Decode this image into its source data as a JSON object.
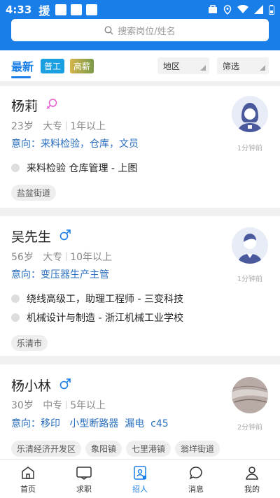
{
  "status_bar": {
    "time": "4:33",
    "carrier_char": "援"
  },
  "search": {
    "placeholder": "搜索岗位/姓名"
  },
  "filters": {
    "latest": "最新",
    "tag_general": "普工",
    "tag_high_pay": "高薪",
    "area": "地区",
    "filter": "筛选"
  },
  "candidates": [
    {
      "name": "杨莉",
      "gender": "female",
      "age": "23岁",
      "education": "大专",
      "experience": "1年以上",
      "intent": "意向：来料检验，仓库，文员",
      "history": [
        "来料检验  仓库管理 - 上图"
      ],
      "locations": [
        "盐盆街道"
      ],
      "ago": "1分钟前"
    },
    {
      "name": "吴先生",
      "gender": "male",
      "age": "56岁",
      "education": "大专",
      "experience": "10年以上",
      "intent": "意向：变压器生产主管",
      "history": [
        "绕线高级工，助理工程师 - 三变科技",
        "机械设计与制造 - 浙江机械工业学校"
      ],
      "locations": [
        "乐清市"
      ],
      "ago": "1分钟前"
    },
    {
      "name": "杨小林",
      "gender": "male",
      "age": "30岁",
      "education": "中专",
      "experience": "5年以上",
      "intent": "意向：移印   小型断路器  漏电  c45",
      "history": [],
      "locations": [
        "乐清经济开发区",
        "象阳镇",
        "七里港镇",
        "翁垟街道"
      ],
      "ago": "2分钟前"
    }
  ],
  "nav": [
    {
      "label": "首页",
      "icon": "home-icon"
    },
    {
      "label": "求职",
      "icon": "job-search-icon"
    },
    {
      "label": "招人",
      "icon": "recruit-icon"
    },
    {
      "label": "消息",
      "icon": "message-icon"
    },
    {
      "label": "我的",
      "icon": "profile-icon"
    }
  ],
  "colors": {
    "accent": "#1a7ee8",
    "male": "#1a7ee8",
    "female": "#e65ad2"
  }
}
